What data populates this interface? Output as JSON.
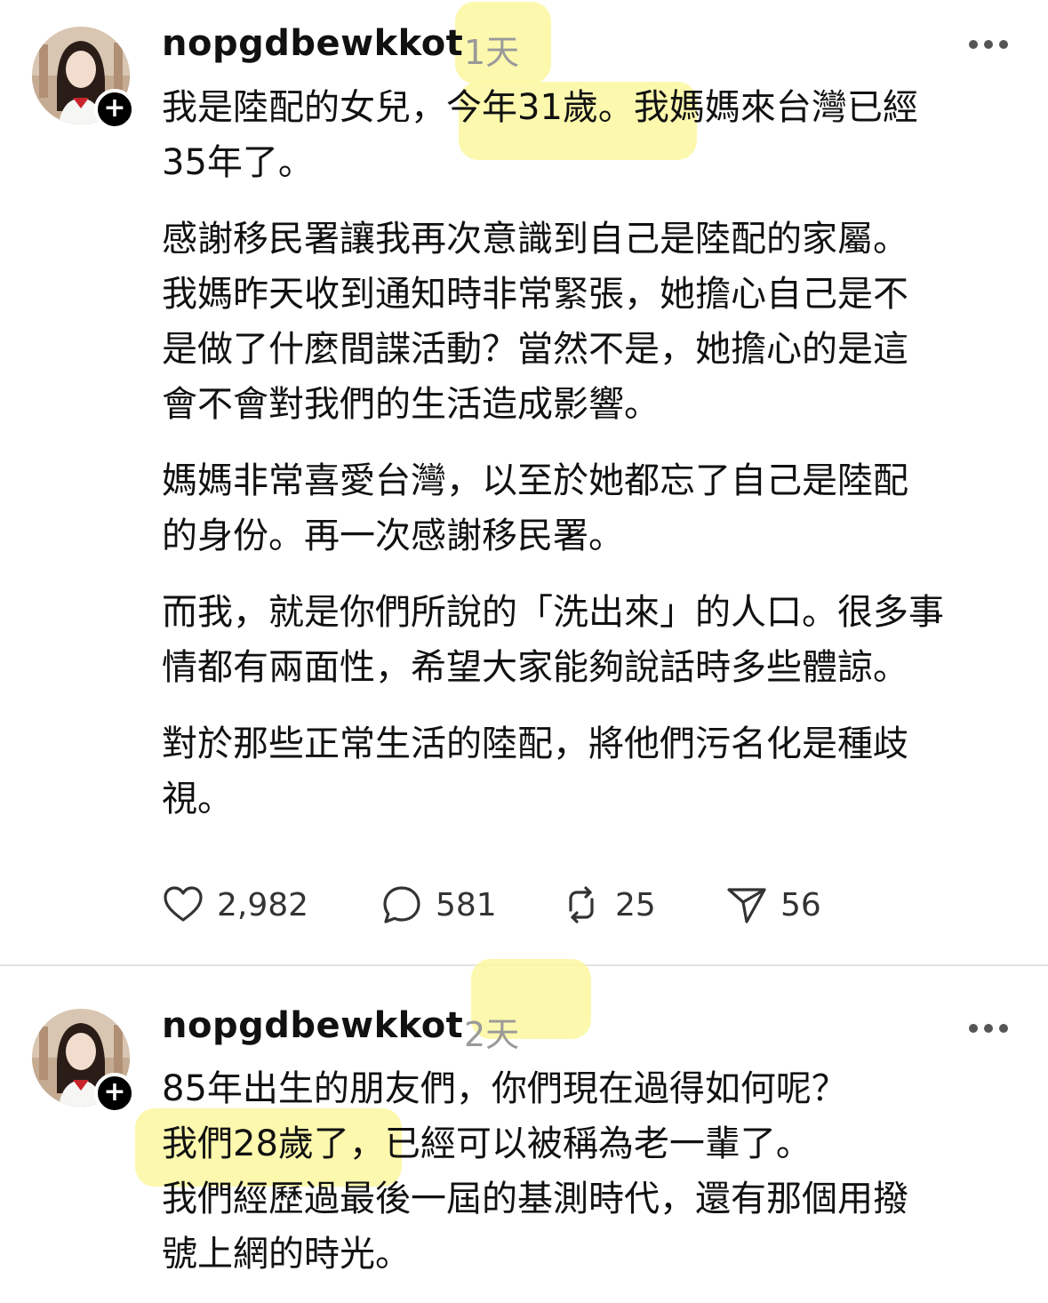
{
  "posts": [
    {
      "username": "nopgdbewkkot",
      "time": "1天",
      "paragraphs": [
        "我是陸配的女兒，今年31歲。我媽媽來台灣已經\n35年了。",
        "感謝移民署讓我再次意識到自己是陸配的家屬。\n我媽昨天收到通知時非常緊張，她擔心自己是不\n是做了什麼間諜活動？當然不是，她擔心的是這\n會不會對我們的生活造成影響。",
        "媽媽非常喜愛台灣，以至於她都忘了自己是陸配\n的身份。再一次感謝移民署。",
        "而我，就是你們所說的「洗出來」的人口。很多事\n情都有兩面性，希望大家能夠說話時多些體諒。",
        "對於那些正常生活的陸配，將他們污名化是種歧\n視。"
      ],
      "stats": {
        "likes": "2,982",
        "comments": "581",
        "reposts": "25",
        "shares": "56"
      },
      "highlights": [
        "1天",
        "今年31歲"
      ]
    },
    {
      "username": "nopgdbewkkot",
      "time": "2天",
      "paragraphs": [
        "85年出生的朋友們，你們現在過得如何呢？\n我們28歲了，已經可以被稱為老一輩了。\n我們經歷過最後一屆的基測時代，還有那個用撥\n號上網的時光。"
      ],
      "highlights": [
        "2天",
        "我們28歲了"
      ]
    }
  ],
  "colors": {
    "highlight": "#fbf7a0",
    "muted": "#9a9a9a",
    "text": "#111111"
  },
  "icons": [
    "plus-icon",
    "more-icon",
    "heart-icon",
    "comment-icon",
    "repost-icon",
    "share-icon"
  ]
}
